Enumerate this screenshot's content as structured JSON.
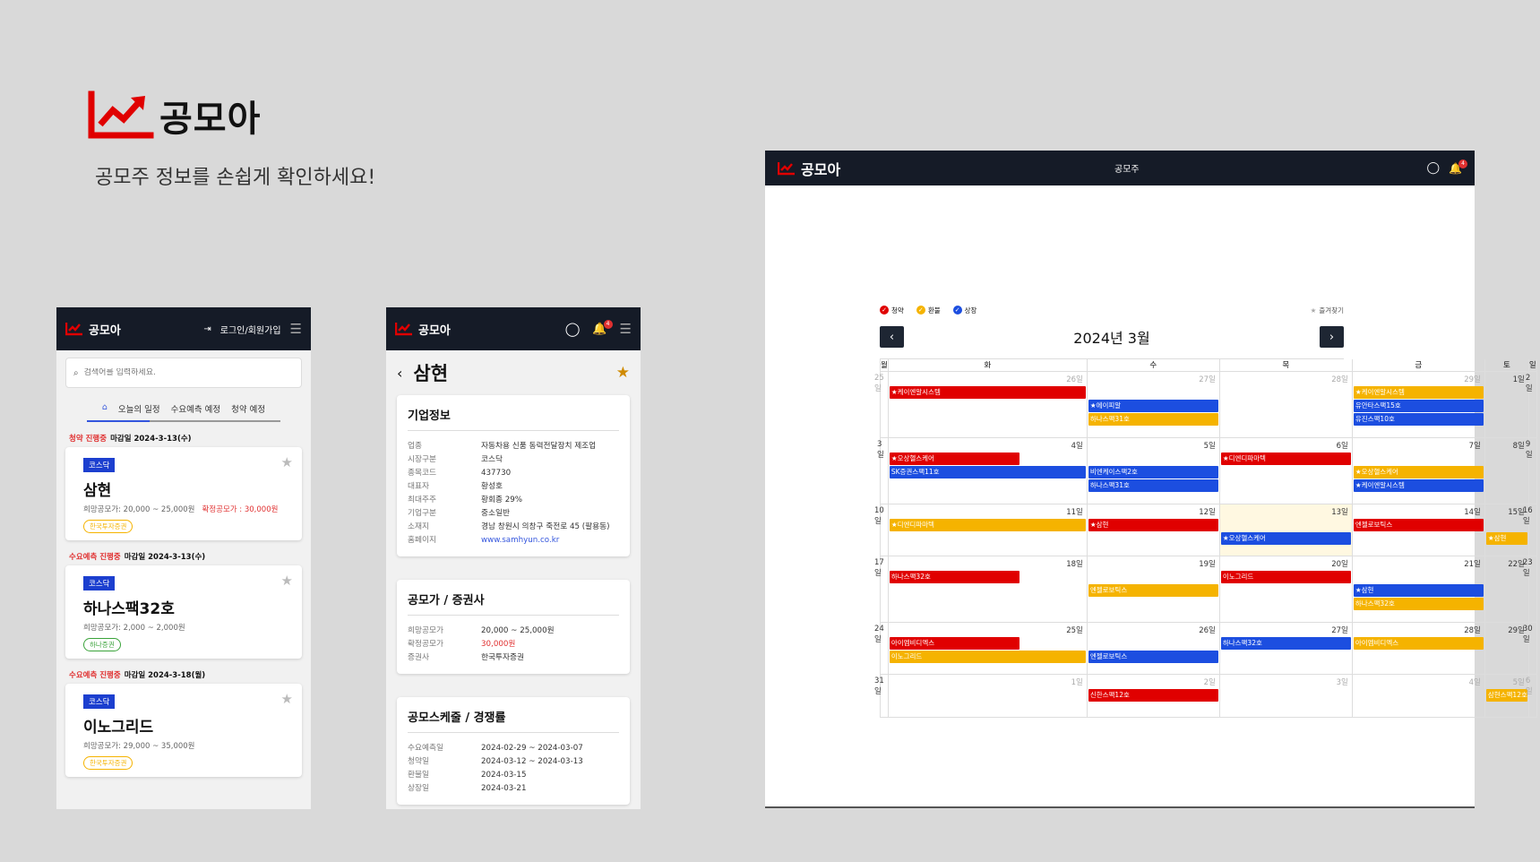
{
  "hero": {
    "brand": "공모아",
    "tagline": "공모주 정보를 손쉽게 확인하세요!"
  },
  "colors": {
    "header": "#151b27",
    "accent_red": "#e00000",
    "accent_yellow": "#f5b300",
    "accent_blue": "#1c4ee0"
  },
  "phone1": {
    "brand": "공모아",
    "login": "로그인/회원가입",
    "search_placeholder": "검색어를 입력하세요.",
    "tabs": [
      "오늘의 일정",
      "수요예측 예정",
      "청약 예정"
    ],
    "sections": [
      {
        "status": "청약 진행중",
        "deadline": "마감일 2024-3-13(수)",
        "market": "코스닥",
        "name": "삼현",
        "range": "희망공모가: 20,000 ~ 25,000원",
        "confirmed": "확정공모가 : 30,000원",
        "broker": "한국투자증권",
        "broker_color": "#f5b300"
      },
      {
        "status": "수요예측 진행중",
        "deadline": "마감일 2024-3-13(수)",
        "market": "코스닥",
        "name": "하나스팩32호",
        "range": "희망공모가: 2,000 ~ 2,000원",
        "confirmed": "",
        "broker": "하나증권",
        "broker_color": "#3aa33a"
      },
      {
        "status": "수요예측 진행중",
        "deadline": "마감일 2024-3-18(월)",
        "market": "코스닥",
        "name": "이노그리드",
        "range": "희망공모가: 29,000 ~ 35,000원",
        "confirmed": "",
        "broker": "한국투자증권",
        "broker_color": "#f5b300"
      }
    ]
  },
  "phone2": {
    "brand": "공모아",
    "notif_count": "4",
    "company": "삼현",
    "info_title": "기업정보",
    "info": [
      {
        "k": "업종",
        "v": "자동차용 신품 동력전달장치 제조업"
      },
      {
        "k": "시장구분",
        "v": "코스닥"
      },
      {
        "k": "종목코드",
        "v": "437730"
      },
      {
        "k": "대표자",
        "v": "황성호"
      },
      {
        "k": "최대주주",
        "v": "황회종 29%"
      },
      {
        "k": "기업구분",
        "v": "중소일반"
      },
      {
        "k": "소재지",
        "v": "경남 창원시 의창구 죽전로 45 (팔용동)"
      },
      {
        "k": "홈페이지",
        "v": "www.samhyun.co.kr"
      }
    ],
    "price_title": "공모가 / 증권사",
    "price": [
      {
        "k": "희망공모가",
        "v": "20,000 ~ 25,000원"
      },
      {
        "k": "확정공모가",
        "v": "30,000원"
      },
      {
        "k": "증권사",
        "v": "한국투자증권"
      }
    ],
    "sched_title": "공모스케줄 / 경쟁률",
    "sched": [
      {
        "k": "수요예측일",
        "v": "2024-02-29 ~ 2024-03-07"
      },
      {
        "k": "청약일",
        "v": "2024-03-12 ~ 2024-03-13"
      },
      {
        "k": "환불일",
        "v": "2024-03-15"
      },
      {
        "k": "상장일",
        "v": "2024-03-21"
      }
    ]
  },
  "desktop": {
    "brand": "공모아",
    "nav_center": "공모주",
    "notif_count": "4",
    "legend": [
      "청약",
      "환불",
      "상장"
    ],
    "favorites": "즐겨찾기",
    "month_title": "2024년 3월",
    "weekdays": [
      "월",
      "화",
      "수",
      "목",
      "금",
      "토",
      "일"
    ],
    "weeks": [
      [
        {
          "d": "25일",
          "o": true,
          "ev": []
        },
        {
          "d": "26일",
          "o": true,
          "ev": [
            {
              "t": "케이엔알시스템",
              "c": "r",
              "s": true,
              "span": 3
            }
          ]
        },
        {
          "d": "27일",
          "o": true,
          "ev": [
            {
              "t": "",
              "c": "gap"
            },
            {
              "t": "에이피알",
              "c": "b",
              "s": true
            },
            {
              "t": "하나스팩31호",
              "c": "y"
            }
          ]
        },
        {
          "d": "28일",
          "o": true,
          "ev": []
        },
        {
          "d": "29일",
          "o": true,
          "ev": [
            {
              "t": "케이엔알시스템",
              "c": "y",
              "s": true
            },
            {
              "t": "유안타스팩15호",
              "c": "b"
            },
            {
              "t": "유진스팩10호",
              "c": "b"
            }
          ]
        },
        {
          "d": "1일",
          "ev": []
        },
        {
          "d": "2일",
          "ev": []
        }
      ],
      [
        {
          "d": "3일",
          "ev": []
        },
        {
          "d": "4일",
          "ev": [
            {
              "t": "오상헬스케어",
              "c": "r",
              "s": true,
              "span": 2
            },
            {
              "t": "SK증권스팩11호",
              "c": "b"
            }
          ]
        },
        {
          "d": "5일",
          "ev": [
            {
              "t": "",
              "c": "gap"
            },
            {
              "t": "비엔케이스팩2호",
              "c": "b"
            },
            {
              "t": "하나스팩31호",
              "c": "b"
            }
          ]
        },
        {
          "d": "6일",
          "ev": [
            {
              "t": "디엔디파마텍",
              "c": "r",
              "s": true,
              "span": 2
            }
          ]
        },
        {
          "d": "7일",
          "ev": [
            {
              "t": "",
              "c": "gap"
            },
            {
              "t": "오상헬스케어",
              "c": "y",
              "s": true
            },
            {
              "t": "케이엔알시스템",
              "c": "b",
              "s": true
            }
          ]
        },
        {
          "d": "8일",
          "ev": []
        },
        {
          "d": "9일",
          "ev": []
        }
      ],
      [
        {
          "d": "10일",
          "ev": []
        },
        {
          "d": "11일",
          "ev": [
            {
              "t": "디엔디파마텍",
              "c": "y",
              "s": true
            }
          ]
        },
        {
          "d": "12일",
          "ev": [
            {
              "t": "삼현",
              "c": "r",
              "s": true,
              "span": 2
            }
          ]
        },
        {
          "d": "13일",
          "today": true,
          "ev": [
            {
              "t": "",
              "c": "gap"
            },
            {
              "t": "오상헬스케어",
              "c": "b",
              "s": true
            }
          ]
        },
        {
          "d": "14일",
          "ev": [
            {
              "t": "엔젤로보틱스",
              "c": "r",
              "span": 2
            }
          ]
        },
        {
          "d": "15일",
          "ev": [
            {
              "t": "",
              "c": "gap"
            },
            {
              "t": "삼현",
              "c": "y",
              "s": true
            }
          ]
        },
        {
          "d": "16일",
          "ev": []
        }
      ],
      [
        {
          "d": "17일",
          "ev": []
        },
        {
          "d": "18일",
          "ev": [
            {
              "t": "하나스팩32호",
              "c": "r",
              "span": 2
            }
          ]
        },
        {
          "d": "19일",
          "ev": [
            {
              "t": "",
              "c": "gap"
            },
            {
              "t": "엔젤로보틱스",
              "c": "y"
            }
          ]
        },
        {
          "d": "20일",
          "ev": [
            {
              "t": "이노그리드",
              "c": "r",
              "span": 2
            }
          ]
        },
        {
          "d": "21일",
          "ev": [
            {
              "t": "",
              "c": "gap"
            },
            {
              "t": "삼현",
              "c": "b",
              "s": true
            },
            {
              "t": "하나스팩32호",
              "c": "y"
            }
          ]
        },
        {
          "d": "22일",
          "ev": []
        },
        {
          "d": "23일",
          "ev": []
        }
      ],
      [
        {
          "d": "24일",
          "ev": []
        },
        {
          "d": "25일",
          "ev": [
            {
              "t": "아이엠비디엑스",
              "c": "r",
              "span": 2
            },
            {
              "t": "이노그리드",
              "c": "y"
            }
          ]
        },
        {
          "d": "26일",
          "ev": [
            {
              "t": "",
              "c": "gap"
            },
            {
              "t": "엔젤로보틱스",
              "c": "b"
            }
          ]
        },
        {
          "d": "27일",
          "ev": [
            {
              "t": "하나스팩32호",
              "c": "b"
            }
          ]
        },
        {
          "d": "28일",
          "ev": [
            {
              "t": "아이엠비디엑스",
              "c": "y"
            }
          ]
        },
        {
          "d": "29일",
          "ev": []
        },
        {
          "d": "30일",
          "ev": []
        }
      ],
      [
        {
          "d": "31일",
          "ev": []
        },
        {
          "d": "1일",
          "o": true,
          "ev": []
        },
        {
          "d": "2일",
          "o": true,
          "ev": [
            {
              "t": "신한스팩12호",
              "c": "r",
              "span": 2
            }
          ]
        },
        {
          "d": "3일",
          "o": true,
          "ev": []
        },
        {
          "d": "4일",
          "o": true,
          "ev": []
        },
        {
          "d": "5일",
          "o": true,
          "ev": [
            {
              "t": "삼현스팩12호",
              "c": "y"
            }
          ]
        },
        {
          "d": "6일",
          "o": true,
          "ev": []
        }
      ]
    ]
  }
}
